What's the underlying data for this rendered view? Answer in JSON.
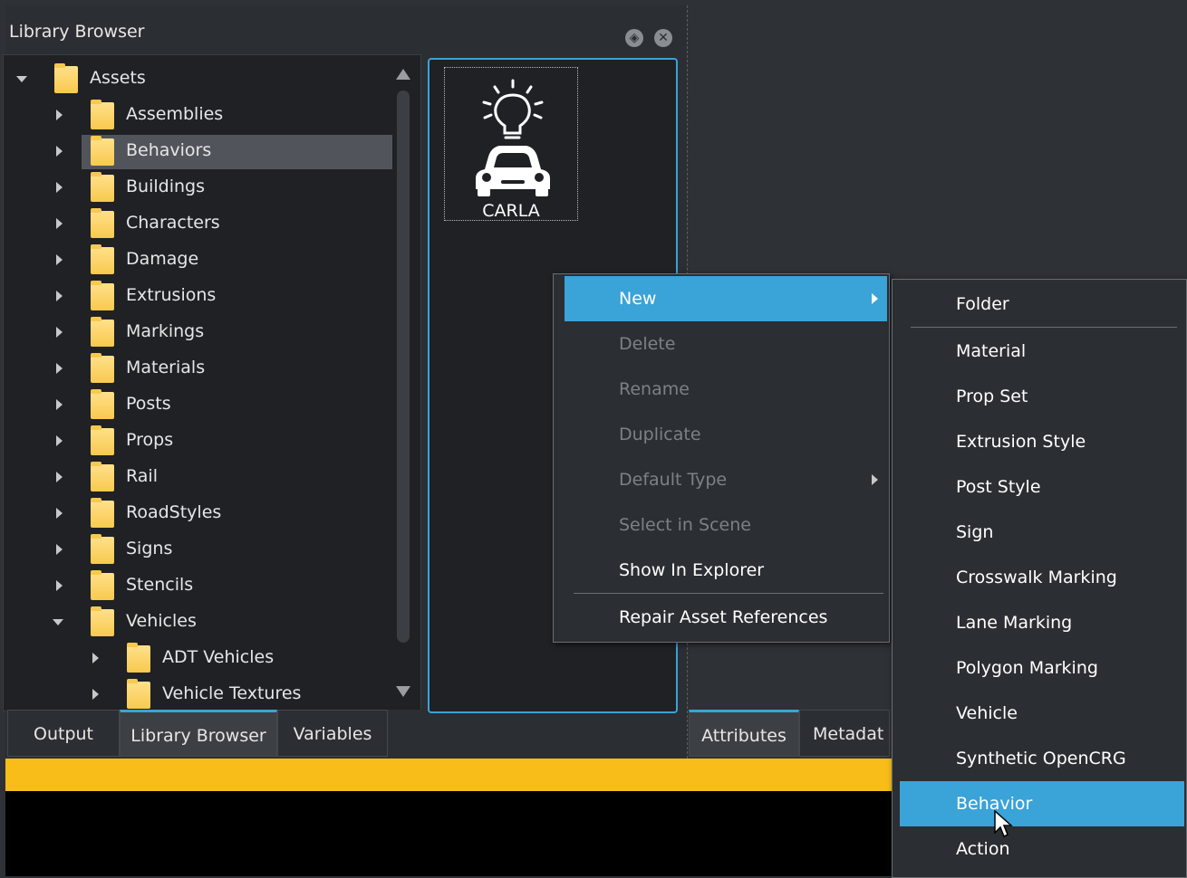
{
  "panel": {
    "title": "Library Browser",
    "float_icon": "◈",
    "close_icon": "✕"
  },
  "tree": {
    "items": [
      {
        "label": "Assets",
        "level": 0,
        "state": "expanded",
        "selected": false
      },
      {
        "label": "Assemblies",
        "level": 1,
        "state": "collapsed",
        "selected": false
      },
      {
        "label": "Behaviors",
        "level": 1,
        "state": "collapsed",
        "selected": true
      },
      {
        "label": "Buildings",
        "level": 1,
        "state": "collapsed",
        "selected": false
      },
      {
        "label": "Characters",
        "level": 1,
        "state": "collapsed",
        "selected": false
      },
      {
        "label": "Damage",
        "level": 1,
        "state": "collapsed",
        "selected": false
      },
      {
        "label": "Extrusions",
        "level": 1,
        "state": "collapsed",
        "selected": false
      },
      {
        "label": "Markings",
        "level": 1,
        "state": "collapsed",
        "selected": false
      },
      {
        "label": "Materials",
        "level": 1,
        "state": "collapsed",
        "selected": false
      },
      {
        "label": "Posts",
        "level": 1,
        "state": "collapsed",
        "selected": false
      },
      {
        "label": "Props",
        "level": 1,
        "state": "collapsed",
        "selected": false
      },
      {
        "label": "Rail",
        "level": 1,
        "state": "collapsed",
        "selected": false
      },
      {
        "label": "RoadStyles",
        "level": 1,
        "state": "collapsed",
        "selected": false
      },
      {
        "label": "Signs",
        "level": 1,
        "state": "collapsed",
        "selected": false
      },
      {
        "label": "Stencils",
        "level": 1,
        "state": "collapsed",
        "selected": false
      },
      {
        "label": "Vehicles",
        "level": 1,
        "state": "expanded",
        "selected": false
      },
      {
        "label": "ADT Vehicles",
        "level": 2,
        "state": "collapsed",
        "selected": false
      },
      {
        "label": "Vehicle Textures",
        "level": 2,
        "state": "collapsed",
        "selected": false
      }
    ]
  },
  "content": {
    "tile_label": "CARLA",
    "tile_icon": "carla-car-lightbulb-icon"
  },
  "bottom_tabs": {
    "output": "Output",
    "library_browser": "Library Browser",
    "variables": "Variables",
    "attributes": "Attributes",
    "metadata": "Metadat"
  },
  "context_menu": {
    "new": "New",
    "delete": "Delete",
    "rename": "Rename",
    "duplicate": "Duplicate",
    "default_type": "Default Type",
    "select_in_scene": "Select in Scene",
    "show_in_explorer": "Show In Explorer",
    "repair_asset_references": "Repair Asset References"
  },
  "submenu": {
    "folder": "Folder",
    "material": "Material",
    "prop_set": "Prop Set",
    "extrusion_style": "Extrusion Style",
    "post_style": "Post Style",
    "sign": "Sign",
    "crosswalk_marking": "Crosswalk Marking",
    "lane_marking": "Lane Marking",
    "polygon_marking": "Polygon Marking",
    "vehicle": "Vehicle",
    "synthetic_opencrg": "Synthetic OpenCRG",
    "behavior": "Behavior",
    "action": "Action"
  },
  "colors": {
    "accent": "#3aa3d8",
    "status_bar": "#f8bd18",
    "folder": "#f8c94e"
  }
}
